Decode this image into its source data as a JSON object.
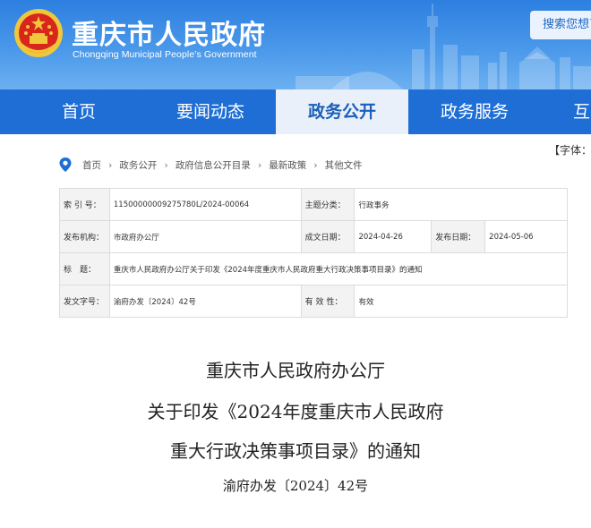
{
  "header": {
    "site_title": "重庆市人民政府",
    "site_subtitle": "Chongqing Municipal People’s Government",
    "search_label": "搜索您想了"
  },
  "nav": {
    "items": [
      {
        "label": "首页",
        "active": false
      },
      {
        "label": "要闻动态",
        "active": false
      },
      {
        "label": "政务公开",
        "active": true
      },
      {
        "label": "政务服务",
        "active": false
      },
      {
        "label": "互",
        "active": false
      }
    ]
  },
  "font_control": "【字体：",
  "breadcrumb": [
    "首页",
    "政务公开",
    "政府信息公开目录",
    "最新政策",
    "其他文件"
  ],
  "info": {
    "index_label": "索 引 号：",
    "index_value": "11500000009275780L/2024-00064",
    "topic_label": "主题分类：",
    "topic_value": "行政事务",
    "issuer_label": "发布机构：",
    "issuer_value": "市政府办公厅",
    "created_label": "成文日期：",
    "created_value": "2024-04-26",
    "published_label": "发布日期：",
    "published_value": "2024-05-06",
    "title_label": "标　题：",
    "title_value": "重庆市人民政府办公厅关于印发《2024年度重庆市人民政府重大行政决策事项目录》的通知",
    "docno_label": "发文字号：",
    "docno_value": "渝府办发〔2024〕42号",
    "validity_label": "有 效 性：",
    "validity_value": "有效"
  },
  "document": {
    "title_line1": "重庆市人民政府办公厅",
    "title_line2": "关于印发《2024年度重庆市人民政府",
    "title_line3": "重大行政决策事项目录》的通知",
    "doc_number": "渝府办发〔2024〕42号"
  },
  "colors": {
    "nav_bg": "#1e6ed6",
    "nav_active_bg": "#e9f0f9",
    "header_bg": "#2d7fe0"
  }
}
